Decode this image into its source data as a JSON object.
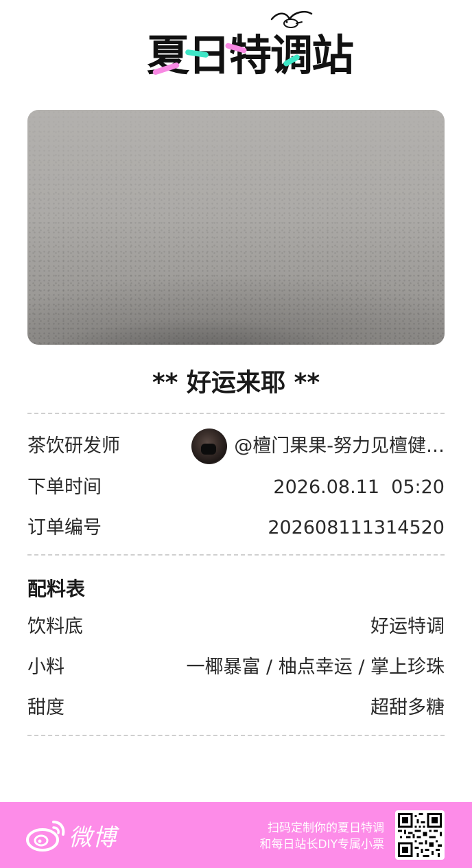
{
  "header": {
    "logo_text": "夏日特调站",
    "logo_icon": "seagull-icon"
  },
  "photo": {
    "description_icon": "drink-photo"
  },
  "order": {
    "title": "** 好运来耶 **",
    "rows": [
      {
        "label": "茶饮研发师",
        "value": "@檀门果果-努力见檀健…"
      },
      {
        "label": "下单时间",
        "value": "2026.08.11  05:20"
      },
      {
        "label": "订单编号",
        "value": "202608111314520"
      }
    ]
  },
  "ingredients": {
    "title": "配料表",
    "rows": [
      {
        "label": "饮料底",
        "value": "好运特调"
      },
      {
        "label": "小料",
        "value": "一椰暴富 / 柚点幸运 / 掌上珍珠"
      },
      {
        "label": "甜度",
        "value": "超甜多糖"
      }
    ]
  },
  "footer": {
    "brand": "微博",
    "line1": "扫码定制你的夏日特调",
    "line2": "和每日站长DIY专属小票",
    "background": "#fd8ce8"
  },
  "colors": {
    "accent_pink": "#f889e3",
    "accent_mint": "#3ee6c6"
  }
}
